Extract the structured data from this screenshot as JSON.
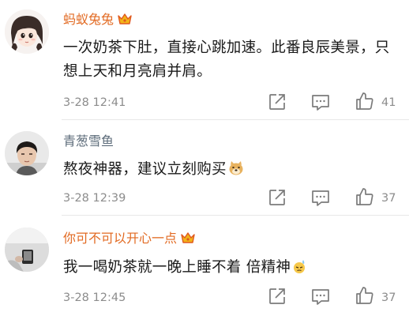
{
  "comments": [
    {
      "username": "蚂蚁兔兔",
      "text": "一次奶茶下肚，直接心跳加速。此番良辰美景，只想上天和月亮肩并肩。",
      "timestamp": "3-28 12:41",
      "likes": "41",
      "vip": true,
      "emoji": null
    },
    {
      "username": "青葱雪鱼",
      "text": "熬夜神器，建议立刻购买",
      "timestamp": "3-28 12:39",
      "likes": "37",
      "vip": false,
      "emoji": "doge-emoji"
    },
    {
      "username": "你可不可以开心一点",
      "text": "我一喝奶茶就一晚上睡不着 倍精神",
      "timestamp": "3-28 12:45",
      "likes": "37",
      "vip": true,
      "emoji": "sweat-emoji"
    }
  ],
  "icons": {
    "share": "share-icon",
    "comment": "comment-icon",
    "like": "thumbs-up-icon",
    "vip": "crown-icon"
  },
  "colors": {
    "vip_username": "#e26a22",
    "normal_username": "#5c6b79",
    "meta_gray": "#8c8c8c"
  }
}
